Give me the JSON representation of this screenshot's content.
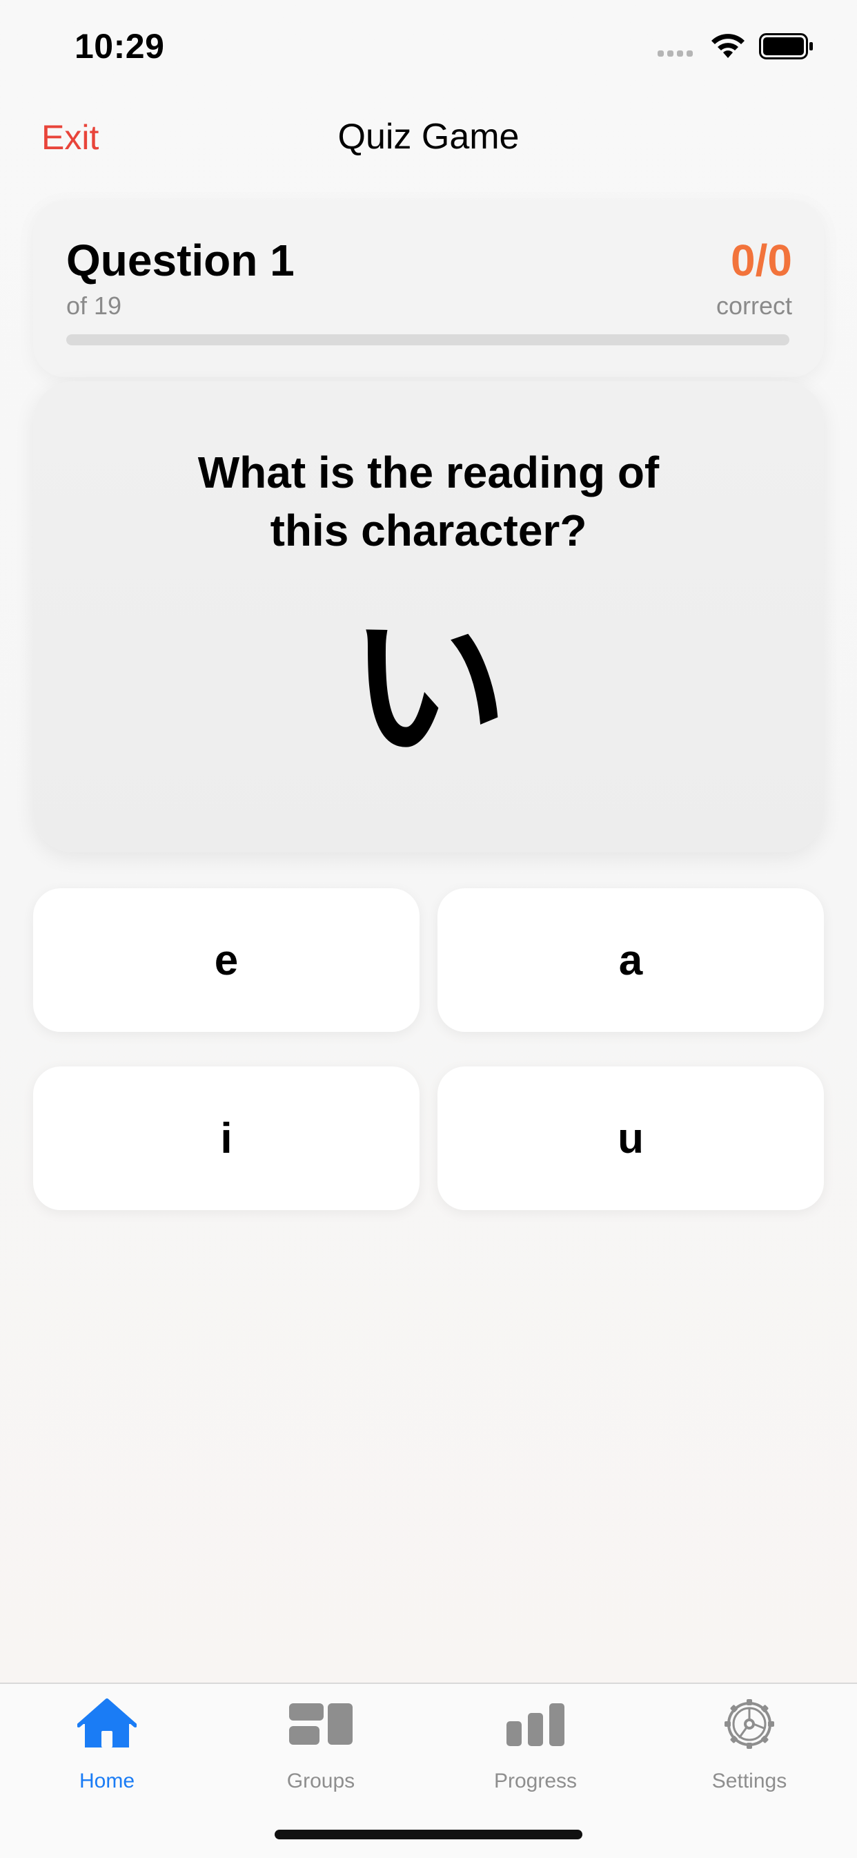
{
  "status_bar": {
    "time": "10:29"
  },
  "nav": {
    "exit_label": "Exit",
    "title": "Quiz Game"
  },
  "progress": {
    "question_label": "Question 1",
    "of_label": "of 19",
    "score": "0/0",
    "score_label": "correct",
    "completion_fraction": 0
  },
  "question": {
    "prompt": "What is the reading of this character?",
    "character": "い"
  },
  "answers": [
    {
      "label": "e"
    },
    {
      "label": "a"
    },
    {
      "label": "i"
    },
    {
      "label": "u"
    }
  ],
  "tabs": [
    {
      "label": "Home",
      "icon": "home-icon",
      "active": true
    },
    {
      "label": "Groups",
      "icon": "groups-icon",
      "active": false
    },
    {
      "label": "Progress",
      "icon": "chart-icon",
      "active": false
    },
    {
      "label": "Settings",
      "icon": "gear-icon",
      "active": false
    }
  ],
  "colors": {
    "exit": "#e8443a",
    "score": "#f2733b",
    "tab_active": "#1a7cf5",
    "tab_inactive": "#8e8e8e"
  }
}
